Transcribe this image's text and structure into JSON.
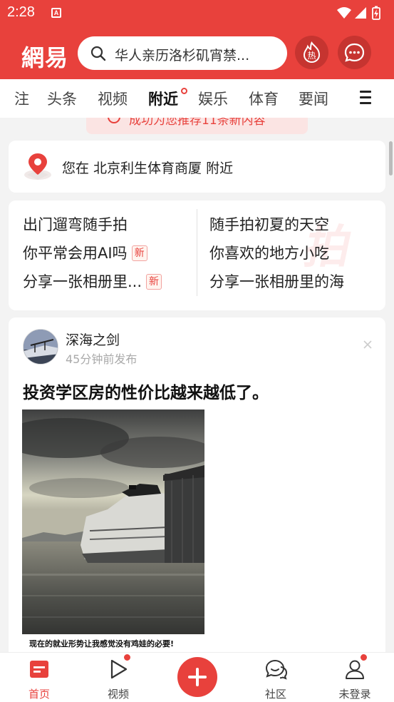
{
  "status_bar": {
    "time": "2:28",
    "notification_icon": "A"
  },
  "header": {
    "logo": "網易",
    "search_placeholder": "华人亲历洛杉矶宵禁...",
    "hot_label": "热",
    "colors": {
      "brand": "#e8413c",
      "button_dark": "#c63430"
    }
  },
  "tabs": [
    {
      "label": "注",
      "active": false
    },
    {
      "label": "头条",
      "active": false
    },
    {
      "label": "视频",
      "active": false
    },
    {
      "label": "附近",
      "active": true
    },
    {
      "label": "娱乐",
      "active": false
    },
    {
      "label": "体育",
      "active": false
    },
    {
      "label": "要闻",
      "active": false
    }
  ],
  "toast": {
    "text": "成功为您推荐11条新内容"
  },
  "location": {
    "text": "您在 北京利生体育商厦 附近"
  },
  "topics": {
    "watermark": "拍",
    "left": [
      {
        "text": "出门遛弯随手拍",
        "badge": ""
      },
      {
        "text": "你平常会用AI吗",
        "badge": "新"
      },
      {
        "text": "分享一张相册里...",
        "badge": "新"
      }
    ],
    "right": [
      {
        "text": "随手拍初夏的天空"
      },
      {
        "text": "你喜欢的地方小吃"
      },
      {
        "text": "分享一张相册里的海"
      }
    ]
  },
  "post": {
    "author": "深海之剑",
    "time": "45分钟前发布",
    "title": "投资学区房的性价比越来越低了。",
    "image_caption": "现在的就业形势让我感觉没有鸡娃的必要!"
  },
  "bottom_nav": {
    "home": "首页",
    "video": "视频",
    "community": "社区",
    "login": "未登录"
  }
}
